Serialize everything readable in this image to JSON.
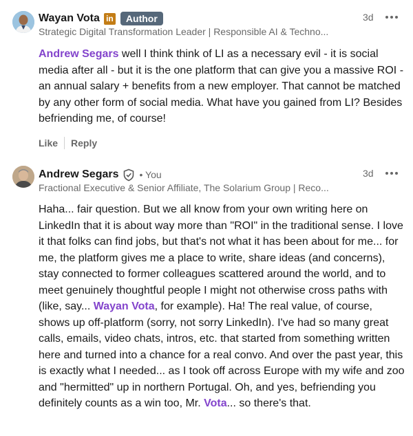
{
  "comments": [
    {
      "author": "Wayan Vota",
      "linkedin_badge": "in",
      "author_badge": "Author",
      "headline": "Strategic Digital Transformation Leader | Responsible AI & Techno...",
      "time": "3d",
      "body": {
        "mention": "Andrew Segars",
        "text": " well I think think of LI as a necessary evil - it is social media after all - but it is the one platform that can give you a massive ROI - an annual salary + benefits from a new employer. That cannot be matched by any other form of social media. What have you gained from LI? Besides befriending me, of course!"
      },
      "actions": {
        "like": "Like",
        "reply": "Reply"
      }
    },
    {
      "author": "Andrew Segars",
      "you_label": "• You",
      "headline": "Fractional Executive & Senior Affiliate, The Solarium Group | Reco...",
      "time": "3d",
      "body": {
        "part1": "Haha... fair question. But we all know from your own writing here on LinkedIn that it is about way more than \"ROI\" in the traditional sense. I love it that folks can find jobs, but that's not what it has been about for me... for me, the platform gives me a place to write, share ideas (and concerns), stay connected to former colleagues scattered around the world, and to meet genuinely thoughtful people I might not otherwise cross paths with (like, say... ",
        "mention1": "Wayan Vota",
        "part2": ", for example). Ha! The real value, of course, shows up off-platform (sorry, not sorry LinkedIn). I've had so many great calls, emails, video chats, intros, etc. that started from something written here and turned into a chance for a real convo. And over the past year, this is exactly what I needed... as I took off across Europe with my wife and zoo and \"hermitted\" up in northern Portugal. Oh, and yes, befriending you definitely counts as a win too, Mr. ",
        "mention2": "Vota",
        "part3": "... so there's that."
      }
    }
  ],
  "icons": [
    "more-options-icon",
    "verified-shield-icon",
    "linkedin-icon"
  ],
  "colors": {
    "mention": "#8344cc",
    "author_badge_bg": "#56687a",
    "linkedin_badge_bg": "#c37d16"
  }
}
